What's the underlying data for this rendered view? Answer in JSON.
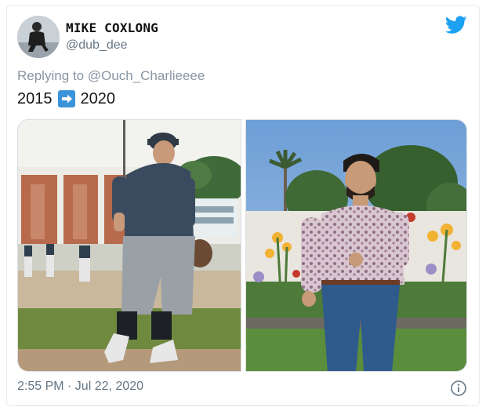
{
  "tweet": {
    "author": {
      "display_name": "MIKE COXLONG",
      "handle": "@dub_dee"
    },
    "reply_to": "Replying to @Ouch_Charlieeee",
    "text_before": "2015",
    "arrow_icon": "right-arrow-emoji-icon",
    "text_after": "2020",
    "timestamp": "2:55 PM · Jul 22, 2020",
    "photos": [
      {
        "subject": "baseball-player-photo"
      },
      {
        "subject": "man-in-garden-photo"
      }
    ]
  },
  "colors": {
    "twitter_blue": "#1da1f2",
    "arrow_blue": "#3b94d9",
    "muted": "#657786"
  }
}
